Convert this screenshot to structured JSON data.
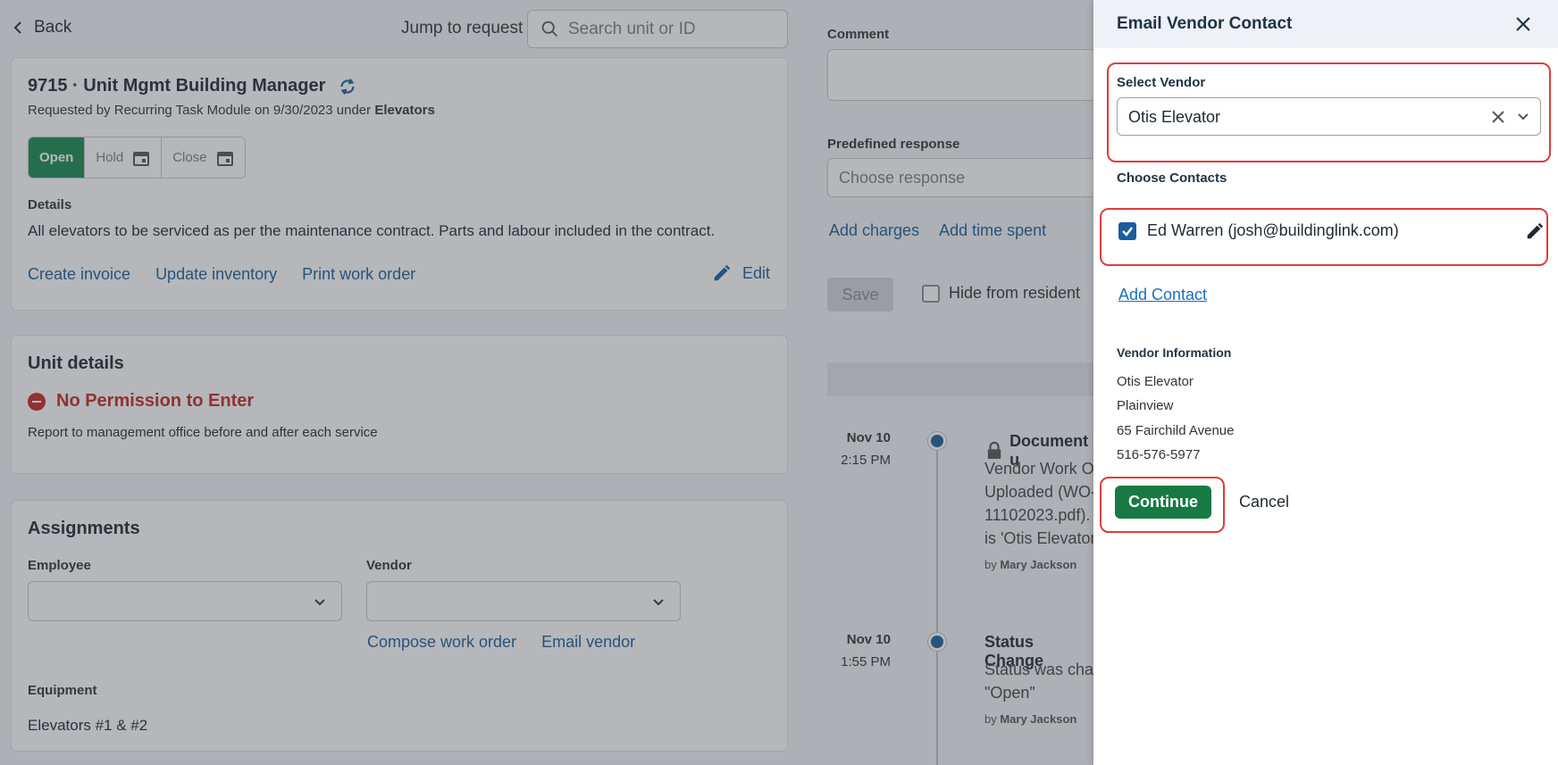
{
  "topbar": {
    "back_label": "Back",
    "jump_label": "Jump to request",
    "search_placeholder": "Search unit or ID"
  },
  "request": {
    "title": "9715 · Unit Mgmt Building Manager",
    "requested_by_prefix": "Requested by Recurring Task Module on 9/30/2023 under ",
    "category": "Elevators",
    "status_tabs": [
      "Open",
      "Hold",
      "Close"
    ],
    "active_status": "Open",
    "details_label": "Details",
    "details_text": "All elevators to be serviced as per the maintenance contract. Parts and labour included in the contract.",
    "links": [
      "Create invoice",
      "Update inventory",
      "Print work order"
    ],
    "edit_label": "Edit"
  },
  "unit_details": {
    "heading": "Unit details",
    "permission": "No Permission to Enter",
    "note": "Report to management office before and after each service"
  },
  "assignments": {
    "heading": "Assignments",
    "employee_label": "Employee",
    "vendor_label": "Vendor",
    "links": [
      "Compose work order",
      "Email vendor"
    ],
    "equipment_label": "Equipment",
    "equipment_value": "Elevators #1 & #2"
  },
  "right_column": {
    "comment_label": "Comment",
    "predefined_label": "Predefined response",
    "predefined_placeholder": "Choose response",
    "links": [
      "Add charges",
      "Add time spent"
    ],
    "save_label": "Save",
    "hide_label": "Hide from resident",
    "timeline": [
      {
        "date": "Nov 10",
        "time": "2:15 PM",
        "title": "Document u",
        "lines": [
          "Vendor Work Or",
          "Uploaded (WO-",
          "11102023.pdf).",
          "is 'Otis Elevator"
        ],
        "by_prefix": "by ",
        "by": "Mary Jackson"
      },
      {
        "date": "Nov 10",
        "time": "1:55 PM",
        "title": "Status Change",
        "lines": [
          "Status was chan",
          "\"Open\""
        ],
        "by_prefix": "by ",
        "by": "Mary Jackson"
      }
    ]
  },
  "drawer": {
    "title": "Email Vendor Contact",
    "select_vendor_label": "Select Vendor",
    "selected_vendor": "Otis Elevator",
    "choose_contacts_label": "Choose Contacts",
    "contact": "Ed Warren (josh@buildinglink.com)",
    "contact_checked": true,
    "add_contact_label": "Add Contact",
    "vendor_info_label": "Vendor Information",
    "vendor_info": [
      "Otis Elevator",
      "Plainview",
      "65 Fairchild Avenue",
      "516-576-5977"
    ],
    "continue_label": "Continue",
    "cancel_label": "Cancel"
  },
  "colors": {
    "accent_blue": "#1a5e9a",
    "open_green": "#188a4f",
    "continue_green": "#177a43",
    "highlight_red": "#e03c3c",
    "no_permission_red": "#c62828"
  }
}
